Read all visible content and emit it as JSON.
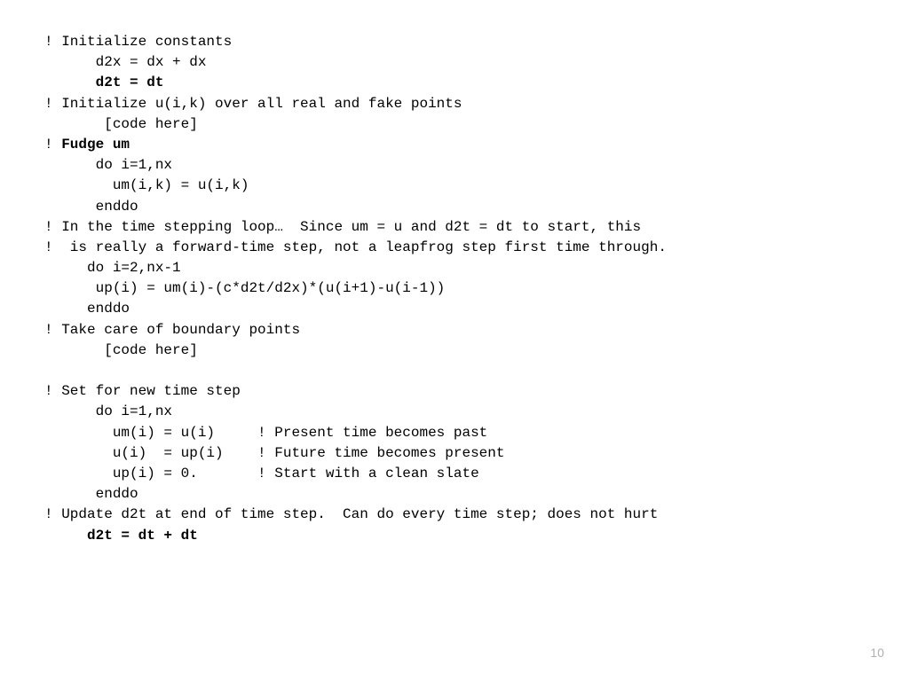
{
  "lines": {
    "l01": "! Initialize constants",
    "l02": "      d2x = dx + dx",
    "l03a": "      ",
    "l03b": "d2t = dt",
    "l04": "! Initialize u(i,k) over all real and fake points",
    "l05": "       [code here]",
    "l06a": "! ",
    "l06b": "Fudge um",
    "l07": "      do i=1,nx",
    "l08": "        um(i,k) = u(i,k)",
    "l09": "      enddo",
    "l10": "! In the time stepping loop…  Since um = u and d2t = dt to start, this",
    "l11": "!  is really a forward-time step, not a leapfrog step first time through.",
    "l12": "     do i=2,nx-1",
    "l13": "      up(i) = um(i)-(c*d2t/d2x)*(u(i+1)-u(i-1))",
    "l14": "     enddo",
    "l15": "! Take care of boundary points",
    "l16": "       [code here]",
    "l17": "! Set for new time step",
    "l18": "      do i=1,nx",
    "l19": "        um(i) = u(i)     ! Present time becomes past",
    "l20": "        u(i)  = up(i)    ! Future time becomes present",
    "l21": "        up(i) = 0.       ! Start with a clean slate",
    "l22": "      enddo",
    "l23": "! Update d2t at end of time step.  Can do every time step; does not hurt",
    "l24a": "     ",
    "l24b": "d2t = dt + dt"
  },
  "page_number": "10"
}
